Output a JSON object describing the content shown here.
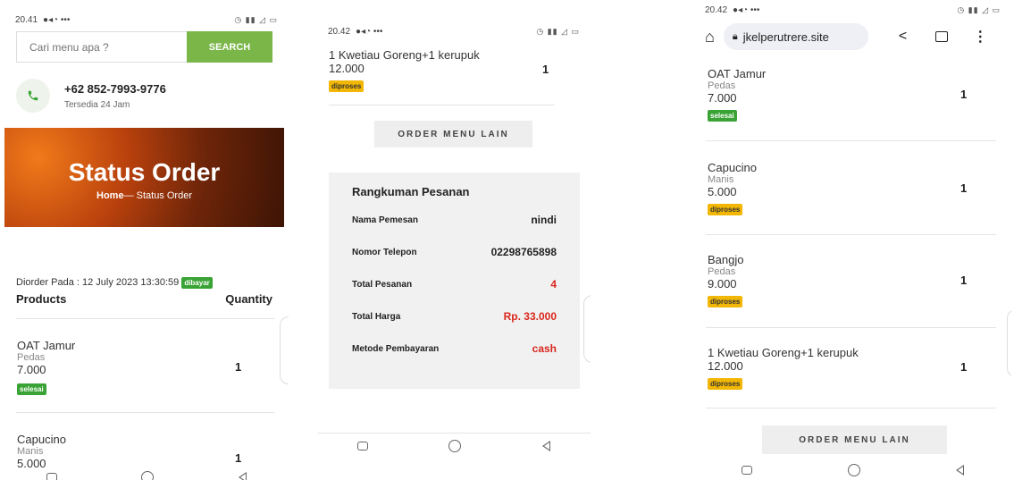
{
  "screen1": {
    "status_time": "20.41",
    "search": {
      "placeholder": "Cari menu apa ?",
      "button": "SEARCH"
    },
    "contact": {
      "phone": "+62 852-7993-9776",
      "availability": "Tersedia 24 Jam"
    },
    "hero": {
      "title": "Status Order",
      "crumb_home": "Home",
      "crumb_sep": "—",
      "crumb_current": "Status Order"
    },
    "order_date_label": "Diorder Pada : 12 July 2023 13:30:59",
    "order_badge": "dibayar",
    "headers": {
      "products": "Products",
      "quantity": "Quantity"
    },
    "items": [
      {
        "name": "OAT Jamur",
        "variant": "Pedas",
        "price": "7.000",
        "status": "selesai",
        "qty": "1"
      },
      {
        "name": "Capucino",
        "variant": "Manis",
        "price": "5.000",
        "qty": "1"
      }
    ]
  },
  "screen2": {
    "status_time": "20.42",
    "item": {
      "name": "1 Kwetiau Goreng+1 kerupuk",
      "price": "12.000",
      "status": "diproses",
      "qty": "1"
    },
    "order_button": "ORDER MENU LAIN",
    "summary": {
      "title": "Rangkuman Pesanan",
      "rows": [
        {
          "label": "Nama Pemesan",
          "value": "nindi"
        },
        {
          "label": "Nomor Telepon",
          "value": "02298765898"
        },
        {
          "label": "Total Pesanan",
          "value": "4"
        },
        {
          "label": "Total Harga",
          "value": "Rp. 33.000"
        },
        {
          "label": "Metode Pembayaran",
          "value": "cash"
        }
      ]
    }
  },
  "screen3": {
    "status_time": "20.42",
    "url": "jkelperutrere.site",
    "items": [
      {
        "name": "OAT Jamur",
        "variant": "Pedas",
        "price": "7.000",
        "status": "selesai",
        "qty": "1"
      },
      {
        "name": "Capucino",
        "variant": "Manis",
        "price": "5.000",
        "status": "diproses",
        "qty": "1"
      },
      {
        "name": "Bangjo",
        "variant": "Pedas",
        "price": "9.000",
        "status": "diproses",
        "qty": "1"
      },
      {
        "name": "1 Kwetiau Goreng+1 kerupuk",
        "price": "12.000",
        "status": "diproses",
        "qty": "1"
      }
    ],
    "order_button": "ORDER MENU LAIN"
  },
  "colors": {
    "green": "#3aa335",
    "yellow": "#f2b705",
    "search_green": "#7ab648",
    "red": "#d9261c"
  }
}
